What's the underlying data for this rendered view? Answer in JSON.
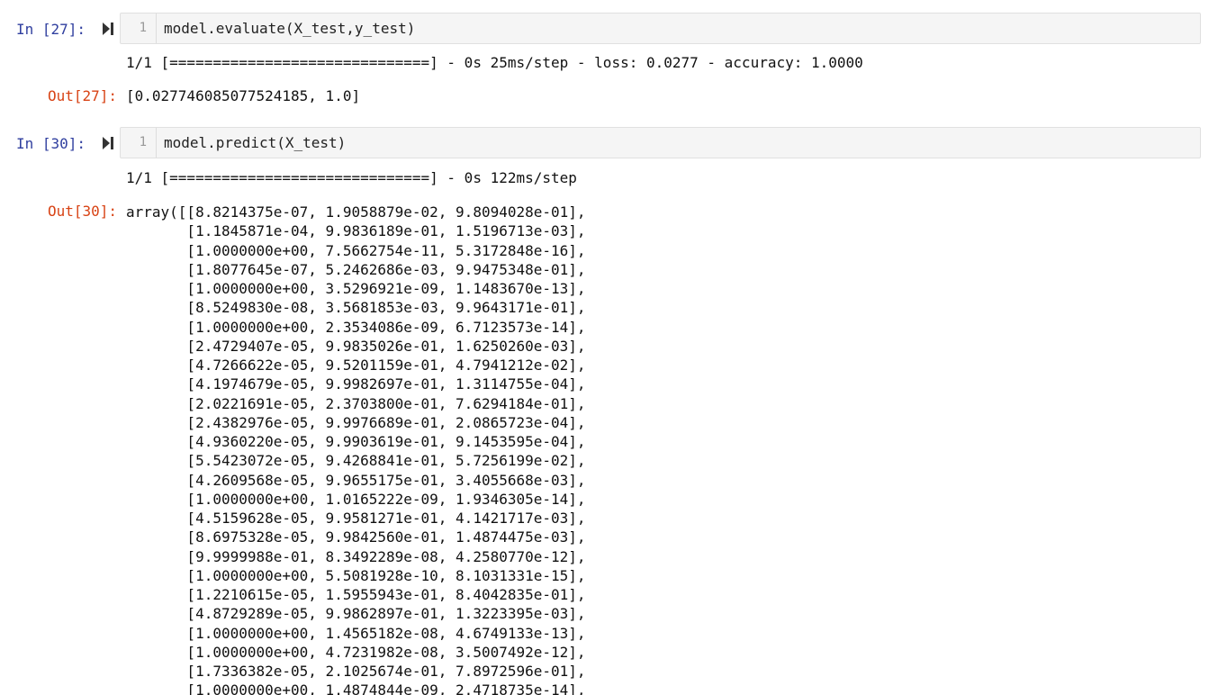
{
  "cells": [
    {
      "in_prompt": "In [27]:",
      "line_number": "1",
      "code": "model.evaluate(X_test,y_test)",
      "stream_output": "1/1 [==============================] - 0s 25ms/step - loss: 0.0277 - accuracy: 1.0000",
      "out_prompt": "Out[27]:",
      "result": "[0.027746085077524185, 1.0]"
    },
    {
      "in_prompt": "In [30]:",
      "line_number": "1",
      "code": "model.predict(X_test)",
      "stream_output": "1/1 [==============================] - 0s 122ms/step",
      "out_prompt": "Out[30]:",
      "array_lines": [
        "array([[8.8214375e-07, 1.9058879e-02, 9.8094028e-01],",
        "       [1.1845871e-04, 9.9836189e-01, 1.5196713e-03],",
        "       [1.0000000e+00, 7.5662754e-11, 5.3172848e-16],",
        "       [1.8077645e-07, 5.2462686e-03, 9.9475348e-01],",
        "       [1.0000000e+00, 3.5296921e-09, 1.1483670e-13],",
        "       [8.5249830e-08, 3.5681853e-03, 9.9643171e-01],",
        "       [1.0000000e+00, 2.3534086e-09, 6.7123573e-14],",
        "       [2.4729407e-05, 9.9835026e-01, 1.6250260e-03],",
        "       [4.7266622e-05, 9.5201159e-01, 4.7941212e-02],",
        "       [4.1974679e-05, 9.9982697e-01, 1.3114755e-04],",
        "       [2.0221691e-05, 2.3703800e-01, 7.6294184e-01],",
        "       [2.4382976e-05, 9.9976689e-01, 2.0865723e-04],",
        "       [4.9360220e-05, 9.9903619e-01, 9.1453595e-04],",
        "       [5.5423072e-05, 9.4268841e-01, 5.7256199e-02],",
        "       [4.2609568e-05, 9.9655175e-01, 3.4055668e-03],",
        "       [1.0000000e+00, 1.0165222e-09, 1.9346305e-14],",
        "       [4.5159628e-05, 9.9581271e-01, 4.1421717e-03],",
        "       [8.6975328e-05, 9.9842560e-01, 1.4874475e-03],",
        "       [9.9999988e-01, 8.3492289e-08, 4.2580770e-12],",
        "       [1.0000000e+00, 5.5081928e-10, 8.1031331e-15],",
        "       [1.2210615e-05, 1.5955943e-01, 8.4042835e-01],",
        "       [4.8729289e-05, 9.9862897e-01, 1.3223395e-03],",
        "       [1.0000000e+00, 1.4565182e-08, 4.6749133e-13],",
        "       [1.0000000e+00, 4.7231982e-08, 3.5007492e-12],",
        "       [1.7336382e-05, 2.1025674e-01, 7.8972596e-01],",
        "       [1.0000000e+00, 1.4874844e-09, 2.4718735e-14],"
      ]
    }
  ],
  "icons": {
    "run": "run-cell-icon"
  },
  "colors": {
    "in_prompt": "#303f9f",
    "out_prompt": "#d84315",
    "code_background": "#f5f5f5"
  }
}
